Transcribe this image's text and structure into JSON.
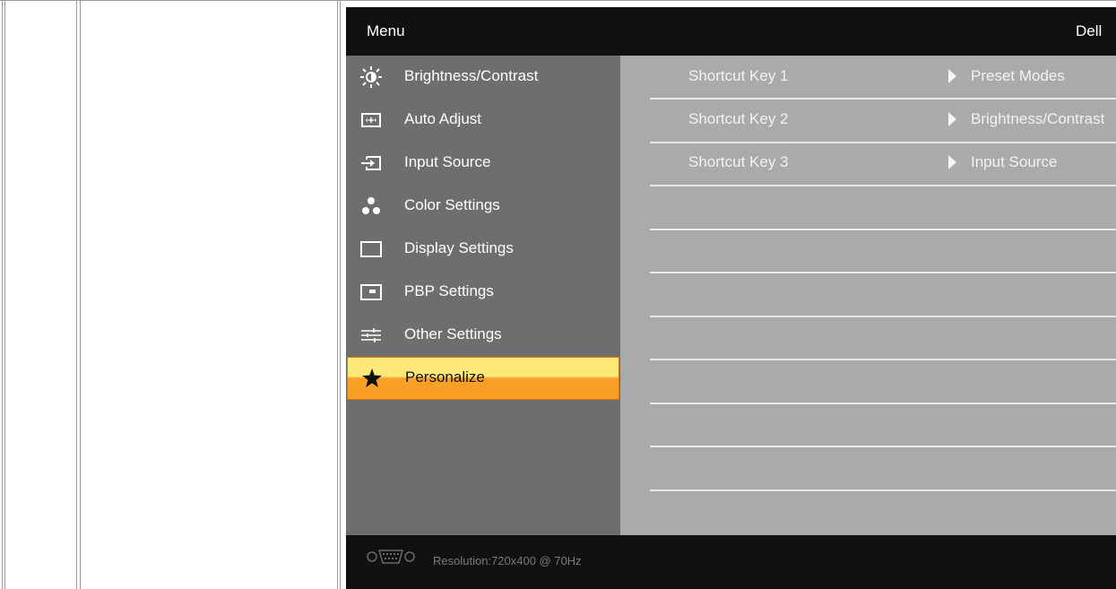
{
  "osd": {
    "title": "Menu",
    "brand": "Dell",
    "menu_items": [
      {
        "label": "Brightness/Contrast",
        "icon": "brightness-icon"
      },
      {
        "label": "Auto Adjust",
        "icon": "auto-adjust-icon"
      },
      {
        "label": "Input Source",
        "icon": "input-source-icon"
      },
      {
        "label": "Color Settings",
        "icon": "color-settings-icon"
      },
      {
        "label": "Display Settings",
        "icon": "display-settings-icon"
      },
      {
        "label": "PBP Settings",
        "icon": "pbp-settings-icon"
      },
      {
        "label": "Other Settings",
        "icon": "other-settings-icon"
      },
      {
        "label": "Personalize",
        "icon": "star-icon",
        "selected": true
      }
    ],
    "shortcuts": [
      {
        "key": "Shortcut Key 1",
        "value": "Preset Modes"
      },
      {
        "key": "Shortcut Key 2",
        "value": "Brightness/Contrast"
      },
      {
        "key": "Shortcut Key 3",
        "value": "Input Source"
      }
    ],
    "footer": {
      "connector_icon": "vga-connector-icon",
      "resolution": "Resolution:720x400 @ 70Hz"
    },
    "colors": {
      "header_bg": "#111111",
      "menu_bg": "#6e6e6e",
      "content_bg": "#aaaaaa",
      "selected_top": "#fde97a",
      "selected_bottom": "#f99d22"
    }
  }
}
